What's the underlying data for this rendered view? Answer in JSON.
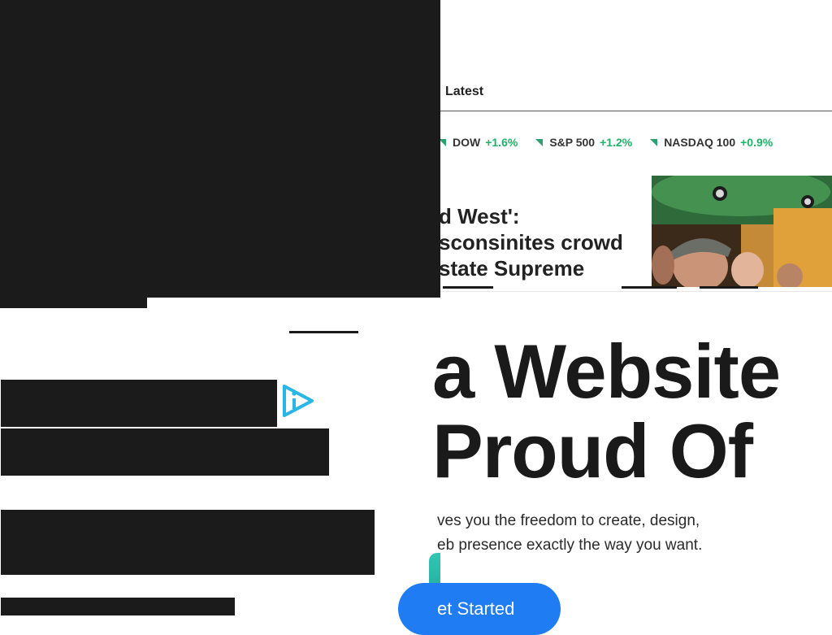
{
  "nav": {
    "latest_label": "Latest"
  },
  "ticker": [
    {
      "symbol": "DOW",
      "change": "+1.6%"
    },
    {
      "symbol": "S&P 500",
      "change": "+1.2%"
    },
    {
      "symbol": "NASDAQ 100",
      "change": "+0.9%"
    }
  ],
  "headline": {
    "lines": [
      "d West':",
      "sconsinites crowd",
      "state Supreme"
    ]
  },
  "ad": {
    "title_line1": "a Website",
    "title_line2": "Proud Of",
    "sub_line1": "ves you the freedom to create, design,",
    "sub_line2": "eb presence exactly the way you want.",
    "cta_label": "et Started"
  },
  "colors": {
    "overlay": "#1b1b1b",
    "ticker_up": "#1fb36a",
    "cta": "#1f7cf2",
    "badge": "#29b6e6"
  },
  "icons": {
    "ad_badge": "adchoices-play-icon"
  }
}
